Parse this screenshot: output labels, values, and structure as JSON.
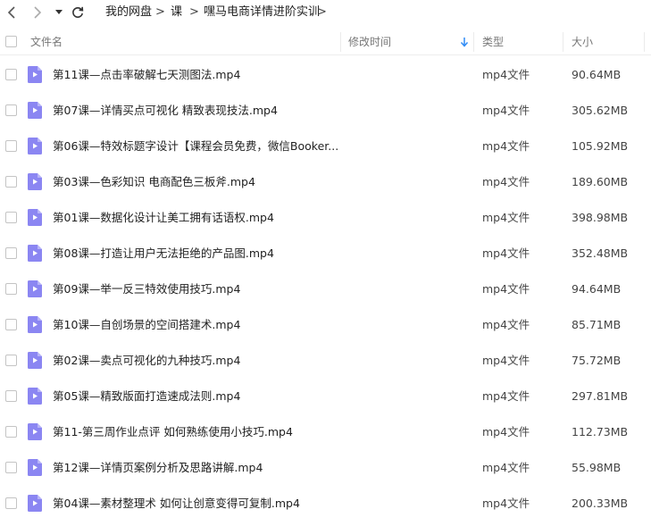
{
  "breadcrumb": {
    "items": [
      "我的网盘",
      "课",
      "嘿马电商详情进阶实训"
    ],
    "separator": ">"
  },
  "columns": {
    "name": "文件名",
    "modified": "修改时间",
    "type": "类型",
    "size": "大小",
    "sort_indicator": "arrow-down-icon"
  },
  "accent_color": "#2f8bf5",
  "file_icon_color": "#8b86f2",
  "files": [
    {
      "name": "第11课—点击率破解七天测图法.mp4",
      "type": "mp4文件",
      "size": "90.64MB"
    },
    {
      "name": "第07课—详情买点可视化 精致表现技法.mp4",
      "type": "mp4文件",
      "size": "305.62MB"
    },
    {
      "name": "第06课—特效标题字设计【课程会员免费，微信Booker...",
      "type": "mp4文件",
      "size": "105.92MB"
    },
    {
      "name": "第03课—色彩知识 电商配色三板斧.mp4",
      "type": "mp4文件",
      "size": "189.60MB"
    },
    {
      "name": "第01课—数据化设计让美工拥有话语权.mp4",
      "type": "mp4文件",
      "size": "398.98MB"
    },
    {
      "name": "第08课—打造让用户无法拒绝的产品图.mp4",
      "type": "mp4文件",
      "size": "352.48MB"
    },
    {
      "name": "第09课—举一反三特效使用技巧.mp4",
      "type": "mp4文件",
      "size": "94.64MB"
    },
    {
      "name": "第10课—自创场景的空间搭建术.mp4",
      "type": "mp4文件",
      "size": "85.71MB"
    },
    {
      "name": "第02课—卖点可视化的九种技巧.mp4",
      "type": "mp4文件",
      "size": "75.72MB"
    },
    {
      "name": "第05课—精致版面打造速成法则.mp4",
      "type": "mp4文件",
      "size": "297.81MB"
    },
    {
      "name": "第11-第三周作业点评 如何熟练使用小技巧.mp4",
      "type": "mp4文件",
      "size": "112.73MB"
    },
    {
      "name": "第12课—详情页案例分析及思路讲解.mp4",
      "type": "mp4文件",
      "size": "55.98MB"
    },
    {
      "name": "第04课—素材整理术 如何让创意变得可复制.mp4",
      "type": "mp4文件",
      "size": "200.33MB"
    }
  ]
}
